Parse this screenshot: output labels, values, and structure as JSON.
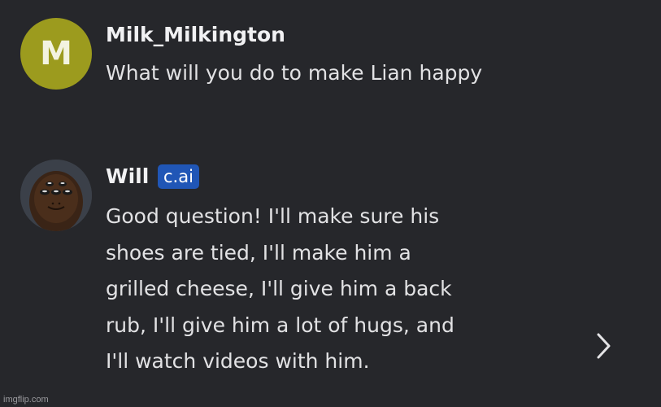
{
  "messages": [
    {
      "author": "Milk_Milkington",
      "avatar_letter": "M",
      "avatar_color": "#9c9b1e",
      "text": "What will you do to make Lian happy"
    },
    {
      "author": "Will",
      "badge": "c.ai",
      "avatar_icon": "character-avatar",
      "lines": [
        "Good question! I'll make sure his",
        "shoes are tied, I'll make him a",
        "grilled cheese, I'll give him a back",
        "rub, I'll give him a lot of hugs, and",
        "I'll watch videos with him."
      ]
    }
  ],
  "navigation": {
    "next_icon": "chevron-right-icon"
  },
  "watermark": "imgflip.com",
  "colors": {
    "background": "#26272b",
    "badge": "#2056b6",
    "text": "#e2e2e4"
  }
}
